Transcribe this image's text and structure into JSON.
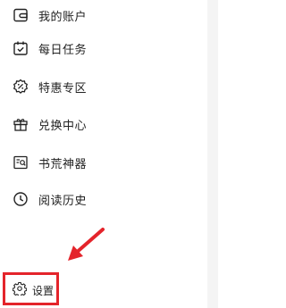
{
  "menu": {
    "items": [
      {
        "label": "我的账户",
        "icon": "wallet-icon"
      },
      {
        "label": "每日任务",
        "icon": "calendar-check-icon"
      },
      {
        "label": "特惠专区",
        "icon": "discount-badge-icon"
      },
      {
        "label": "兑换中心",
        "icon": "gift-icon"
      },
      {
        "label": "书荒神器",
        "icon": "book-search-icon"
      },
      {
        "label": "阅读历史",
        "icon": "clock-icon"
      }
    ],
    "settings": {
      "label": "设置",
      "icon": "gear-icon"
    }
  },
  "annotation": {
    "arrow_color": "#e4242b",
    "highlight_color": "#e4242b"
  }
}
